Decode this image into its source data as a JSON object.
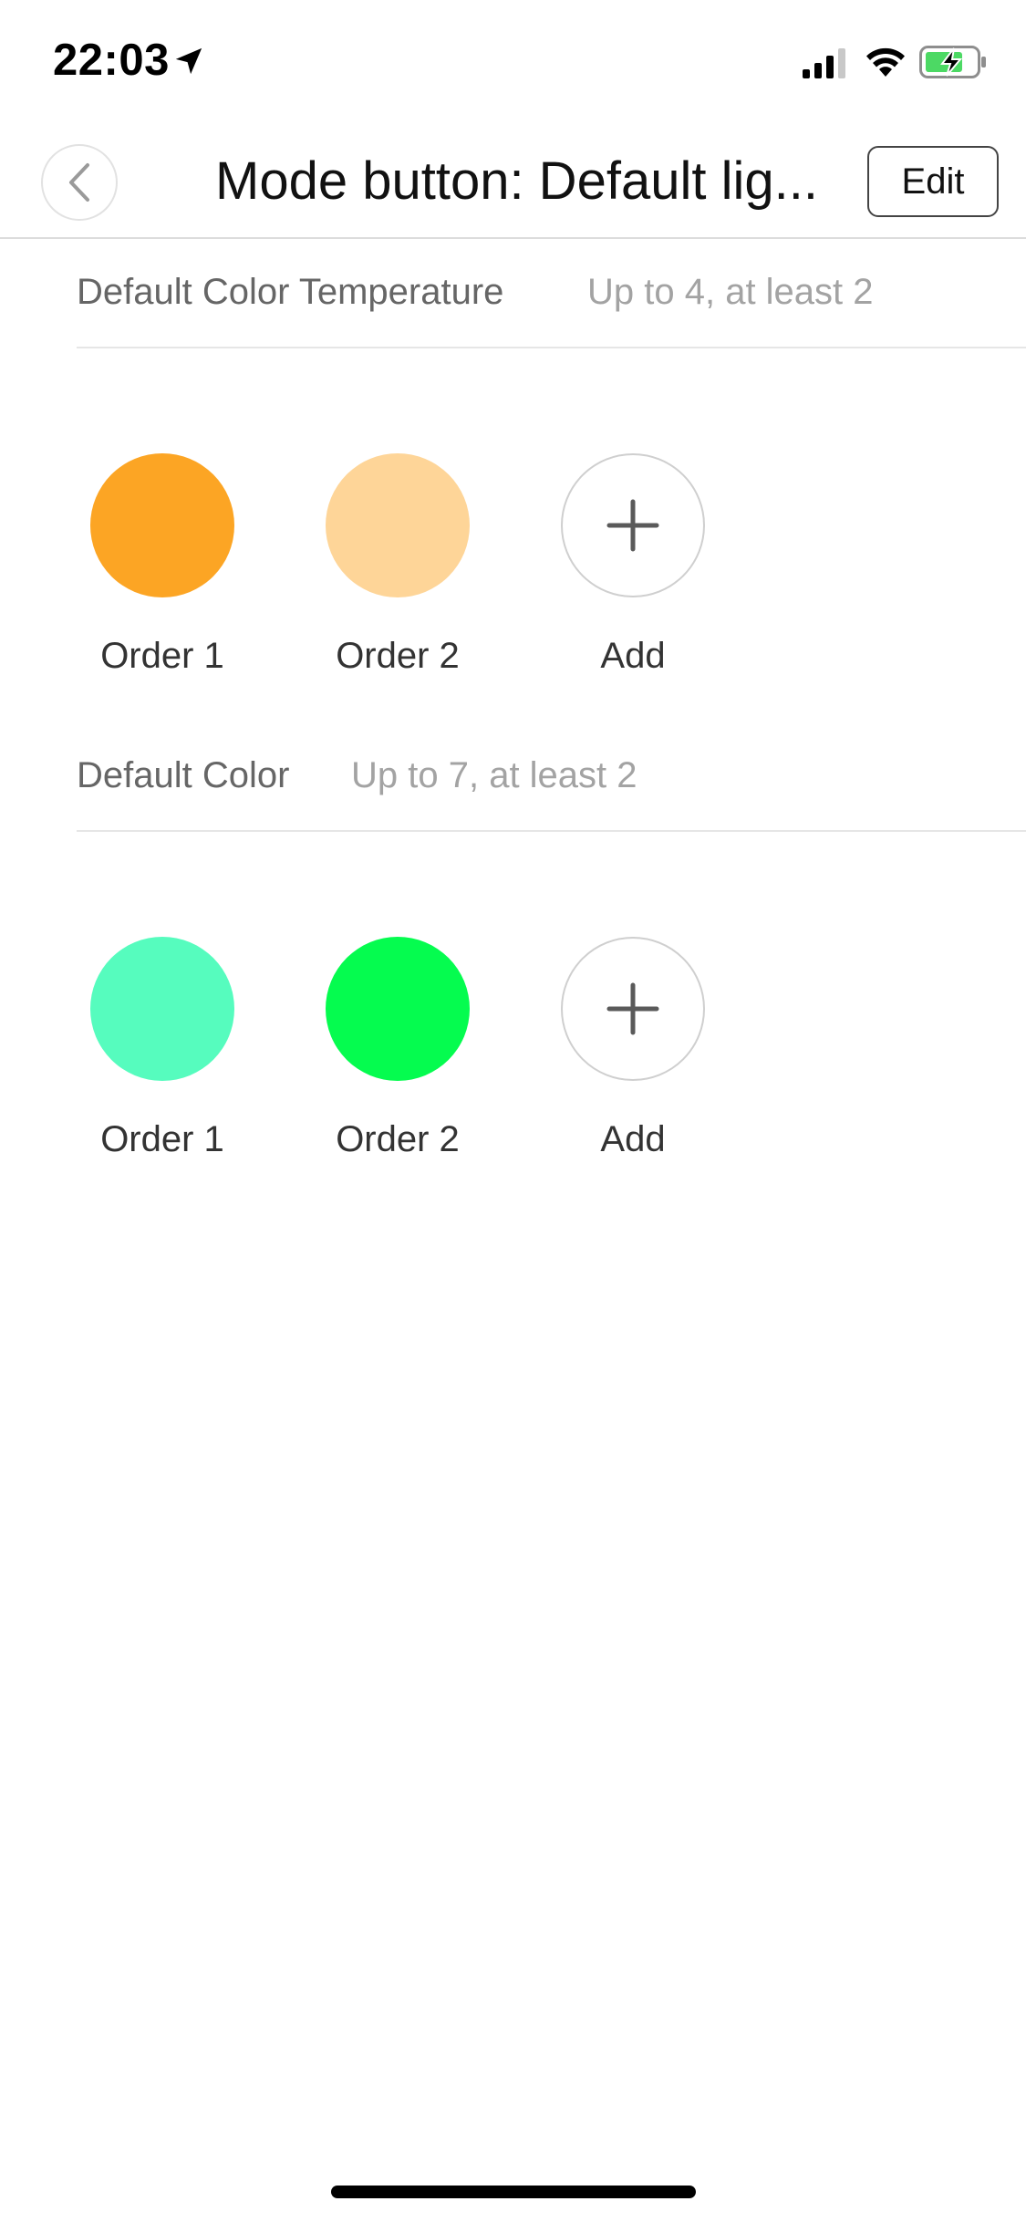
{
  "status_bar": {
    "time": "22:03",
    "location_icon": "location-arrow-icon",
    "signal_icon": "cellular-signal-icon",
    "wifi_icon": "wifi-icon",
    "battery_icon": "battery-charging-icon",
    "battery_color": "#4cd964"
  },
  "nav": {
    "back_icon": "chevron-left-icon",
    "title": "Mode button: Default lig...",
    "edit_label": "Edit"
  },
  "sections": [
    {
      "title": "Default Color Temperature",
      "hint": "Up to 4, at least 2",
      "swatches": [
        {
          "label": "Order 1",
          "color": "#fca524"
        },
        {
          "label": "Order 2",
          "color": "#fed598"
        }
      ],
      "add_label": "Add",
      "add_icon": "plus-icon"
    },
    {
      "title": "Default Color",
      "hint": "Up to 7, at least 2",
      "swatches": [
        {
          "label": "Order 1",
          "color": "#56fcbe"
        },
        {
          "label": "Order 2",
          "color": "#05fc4f"
        }
      ],
      "add_label": "Add",
      "add_icon": "plus-icon"
    }
  ]
}
